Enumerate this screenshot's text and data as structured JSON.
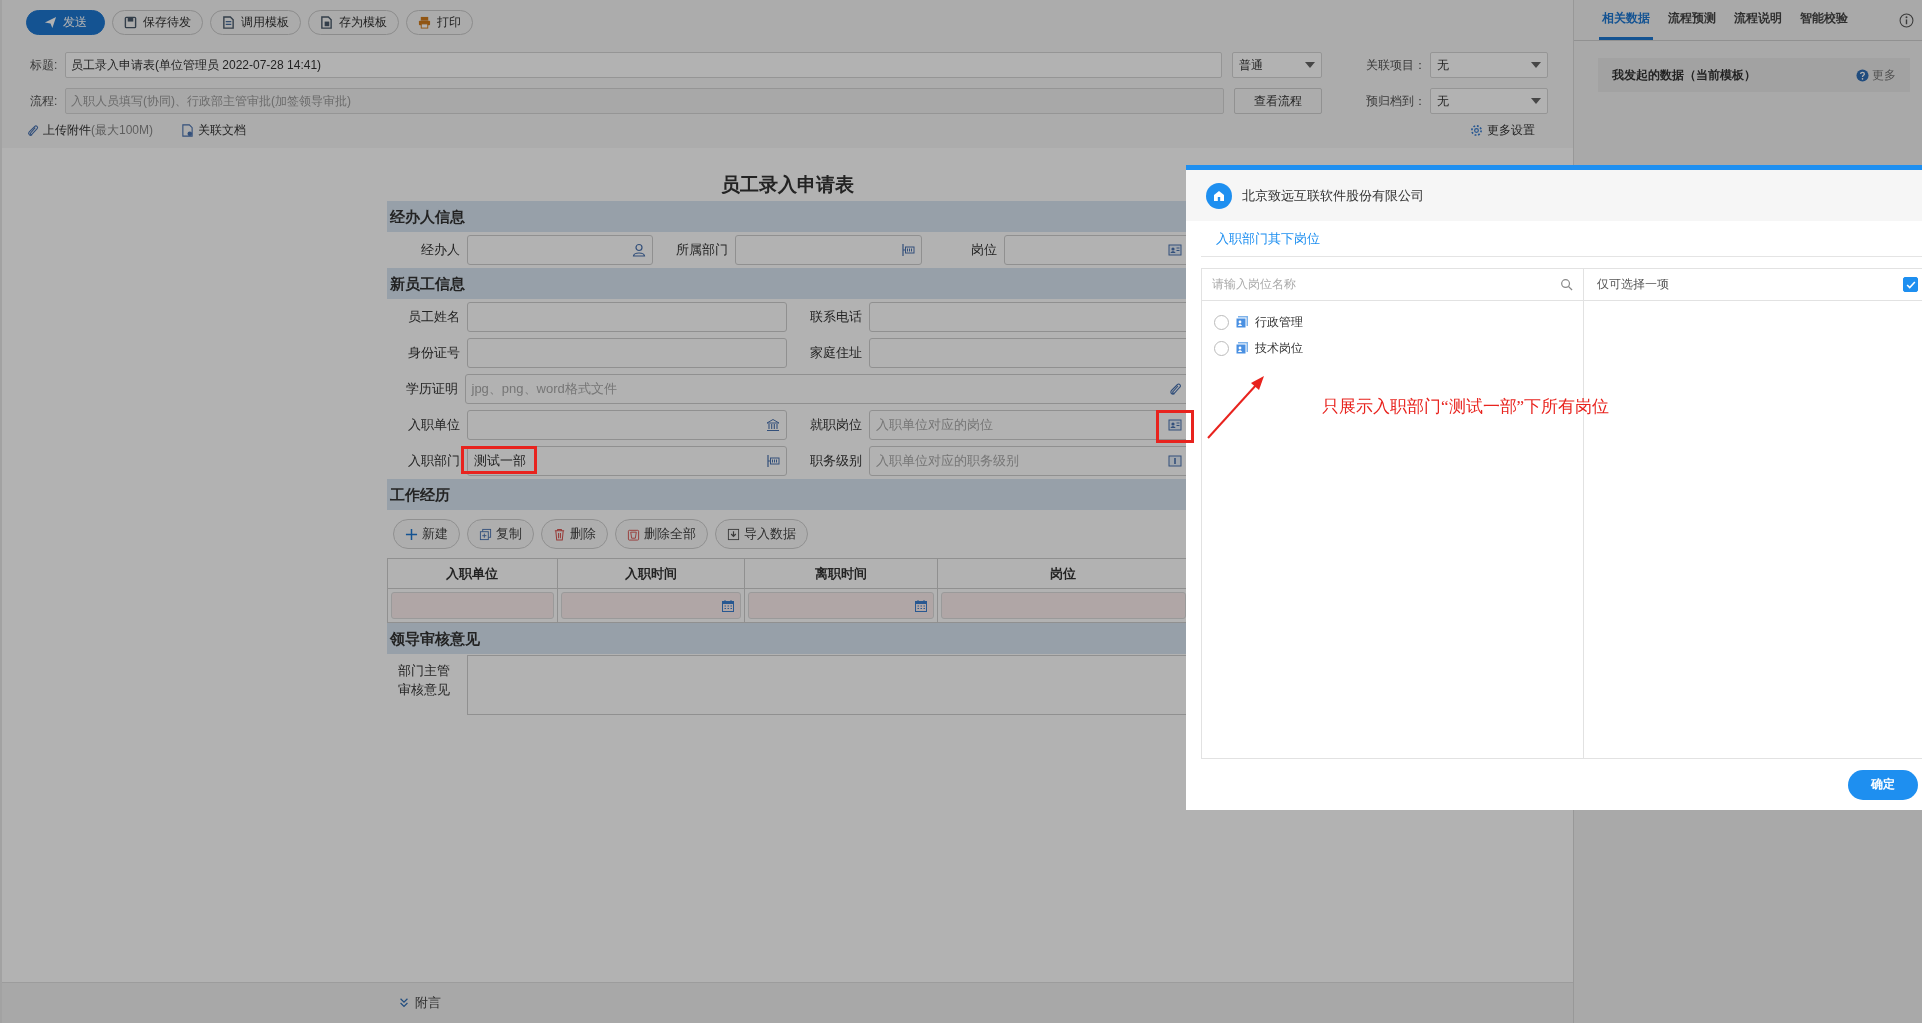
{
  "toolbar": {
    "buttons": [
      {
        "label": "发送",
        "kind": "send"
      },
      {
        "label": "保存待发",
        "kind": "save"
      },
      {
        "label": "调用模板",
        "kind": "template"
      },
      {
        "label": "存为模板",
        "kind": "saveas"
      },
      {
        "label": "打印",
        "kind": "print"
      }
    ]
  },
  "header": {
    "title_label": "标题:",
    "title_value": "员工录入申请表(单位管理员 2022-07-28 14:41)",
    "priority": "普通",
    "related_project_label": "关联项目：",
    "related_project": "无",
    "flow_label": "流程:",
    "flow_value": "入职人员填写(协同)、行政部主管审批(加签领导审批)",
    "view_flow_button": "查看流程",
    "archive_label": "预归档到：",
    "archive": "无",
    "attach_label": "上传附件",
    "attach_hint": "(最大100M)",
    "related_doc": "关联文档",
    "more_settings": "更多设置"
  },
  "form": {
    "title": "员工录入申请表",
    "sections": [
      {
        "title": "经办人信息",
        "kind": "fields",
        "rows": [
          {
            "fields": [
              {
                "label": "经办人",
                "kind": "person"
              },
              {
                "label": "所属部门",
                "kind": "department"
              },
              {
                "label": "岗位",
                "kind": "post"
              }
            ]
          }
        ]
      },
      {
        "title": "新员工信息",
        "kind": "fields",
        "rows": [
          {
            "fields": [
              {
                "label": "员工姓名",
                "kind": "text"
              },
              {
                "label": "联系电话",
                "kind": "text"
              }
            ]
          },
          {
            "fields": [
              {
                "label": "身份证号",
                "kind": "text"
              },
              {
                "label": "家庭住址",
                "kind": "text"
              }
            ]
          },
          {
            "fields": [
              {
                "label": "学历证明",
                "placeholder": "jpg、png、word格式文件",
                "kind": "attach"
              }
            ]
          },
          {
            "fields": [
              {
                "label": "入职单位",
                "kind": "unit"
              },
              {
                "label": "就职岗位",
                "placeholder": "入职单位对应的岗位",
                "kind": "post",
                "icon_marked": true
              }
            ]
          },
          {
            "fields": [
              {
                "label": "入职部门",
                "value": "测试一部",
                "kind": "department",
                "value_marked": true
              },
              {
                "label": "职务级别",
                "placeholder": "入职单位对应的职务级别",
                "kind": "level"
              }
            ]
          }
        ]
      },
      {
        "title": "工作经历",
        "kind": "table",
        "buttons": [
          {
            "label": "新建",
            "kind": "add"
          },
          {
            "label": "复制",
            "kind": "copy"
          },
          {
            "label": "删除",
            "kind": "delete"
          },
          {
            "label": "删除全部",
            "kind": "deleteall"
          },
          {
            "label": "导入数据",
            "kind": "import"
          }
        ],
        "columns": [
          {
            "label": "入职单位",
            "kind": "text"
          },
          {
            "label": "入职时间",
            "kind": "date"
          },
          {
            "label": "离职时间",
            "kind": "date"
          },
          {
            "label": "岗位",
            "kind": "text"
          }
        ]
      },
      {
        "title": "领导审核意见",
        "kind": "opinion",
        "label": "部门主管审核意见"
      }
    ]
  },
  "footer": {
    "label": "附言"
  },
  "side_panel": {
    "tabs": [
      {
        "label": "相关数据",
        "selected": true
      },
      {
        "label": "流程预测",
        "selected": false
      },
      {
        "label": "流程说明",
        "selected": false
      },
      {
        "label": "智能校验",
        "selected": false
      }
    ],
    "card": {
      "title": "我发起的数据（当前模板）",
      "more": "更多"
    }
  },
  "dialog": {
    "org": "北京致远互联软件股份有限公司",
    "tab": "入职部门其下岗位",
    "search_placeholder": "请输入岗位名称",
    "single_select_label": "仅可选择一项",
    "single_select_checked": true,
    "items": [
      {
        "label": "行政管理",
        "selected": false
      },
      {
        "label": "技术岗位",
        "selected": false
      }
    ],
    "confirm": "确定"
  },
  "annotation": {
    "note": "只展示入职部门“测试一部”下所有岗位"
  }
}
